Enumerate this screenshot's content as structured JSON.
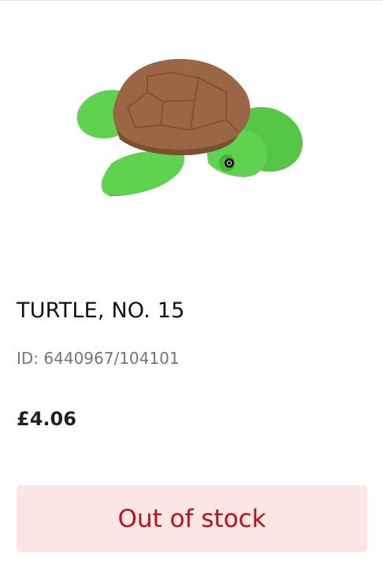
{
  "product": {
    "image_name": "turtle-minifigure-image",
    "title": "TURTLE, NO. 15",
    "id_text": "ID: 6440967/104101",
    "price": "£4.06",
    "stock_label": "Out of stock"
  },
  "colors": {
    "button_bg": "#fbe5e5",
    "button_text": "#b8121a",
    "shell": "#9a6644",
    "body": "#5fd24f"
  }
}
